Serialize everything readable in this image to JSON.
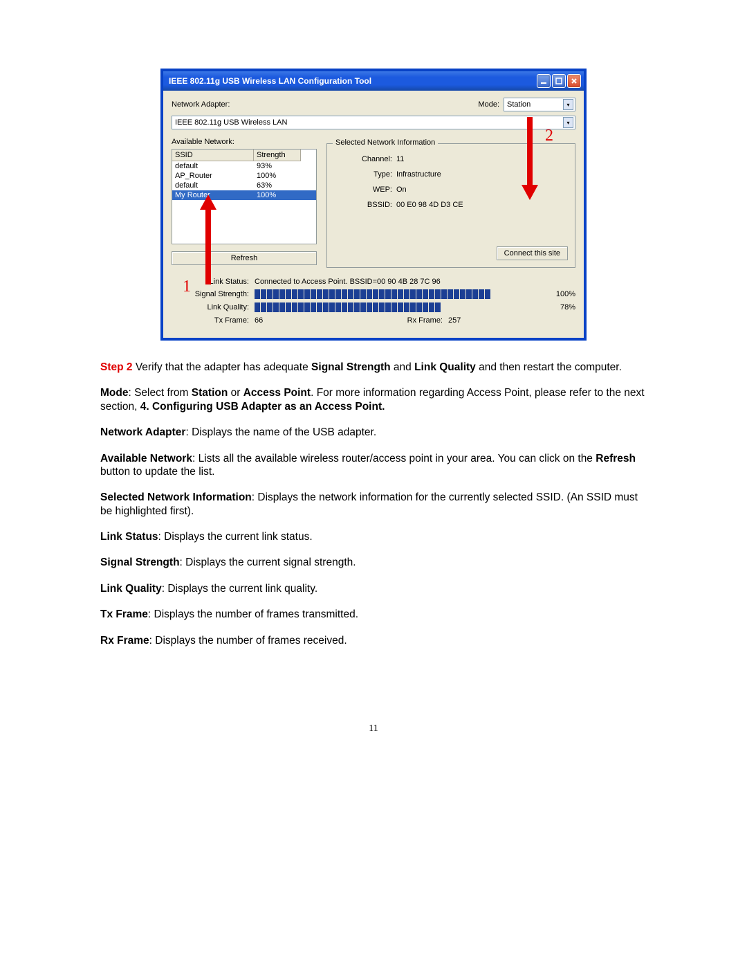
{
  "dialog": {
    "title": "IEEE 802.11g USB Wireless LAN Configuration Tool",
    "labels": {
      "networkAdapter": "Network Adapter:",
      "mode": "Mode:",
      "modeValue": "Station",
      "adapterValue": "IEEE 802.11g USB Wireless LAN",
      "availableNetwork": "Available Network:",
      "colSSID": "SSID",
      "colStrength": "Strength",
      "refresh": "Refresh",
      "selectedInfo": "Selected Network Information",
      "channel": "Channel:",
      "type": "Type:",
      "wep": "WEP:",
      "bssid": "BSSID:",
      "connect": "Connect this site",
      "linkStatus": "Link Status:",
      "signalStrength": "Signal Strength:",
      "linkQuality": "Link Quality:",
      "txFrame": "Tx Frame:",
      "rxFrame": "Rx Frame:"
    },
    "networks": [
      {
        "ssid": "default",
        "strength": "93%"
      },
      {
        "ssid": "AP_Router",
        "strength": "100%"
      },
      {
        "ssid": "default",
        "strength": "63%"
      },
      {
        "ssid": "My Router",
        "strength": "100%"
      }
    ],
    "selectedNetwork": {
      "channel": "11",
      "type": "Infrastructure",
      "wep": "On",
      "bssid": "00 E0 98 4D D3 CE"
    },
    "status": {
      "link": "Connected to Access Point. BSSID=00 90 4B 28 7C 96",
      "signalPct": "100%",
      "qualityPct": "78%",
      "txFrame": "66",
      "rxFrame": "257"
    },
    "callouts": {
      "c1": "1",
      "c2": "2"
    }
  },
  "doc": {
    "step2_prefix": "Step 2",
    "step2_body1": " Verify that the adapter has adequate ",
    "step2_sig": "Signal Strength",
    "step2_and": " and ",
    "step2_lq": "Link Quality",
    "step2_rest": " and then restart the computer.",
    "mode_b": "Mode",
    "mode_t1": ": Select from ",
    "mode_st": "Station",
    "mode_or": " or ",
    "mode_ap": "Access Point",
    "mode_t2": ". For more information regarding Access Point, please refer to the next section, ",
    "mode_b2": "4. Configuring USB Adapter as an Access Point.",
    "na_b": "Network Adapter",
    "na_t": ": Displays the name of the USB adapter.",
    "av_b": "Available Network",
    "av_t1": ": Lists all the available wireless router/access point in your area. You can click on the ",
    "av_ref": "Refresh",
    "av_t2": " button to update the list.",
    "sni_b": "Selected Network Information",
    "sni_t": ": Displays the network information for the currently selected SSID. (An SSID must be highlighted first).",
    "ls_b": "Link Status",
    "ls_t": ": Displays the current link status.",
    "ss_b": "Signal Strength",
    "ss_t": ": Displays the current signal strength.",
    "lq_b": "Link Quality",
    "lq_t": ": Displays the current link quality.",
    "tx_b": "Tx Frame",
    "tx_t": ": Displays the number of frames transmitted.",
    "rx_b": "Rx Frame",
    "rx_t": ": Displays the number of frames received.",
    "pageNumber": "11"
  }
}
